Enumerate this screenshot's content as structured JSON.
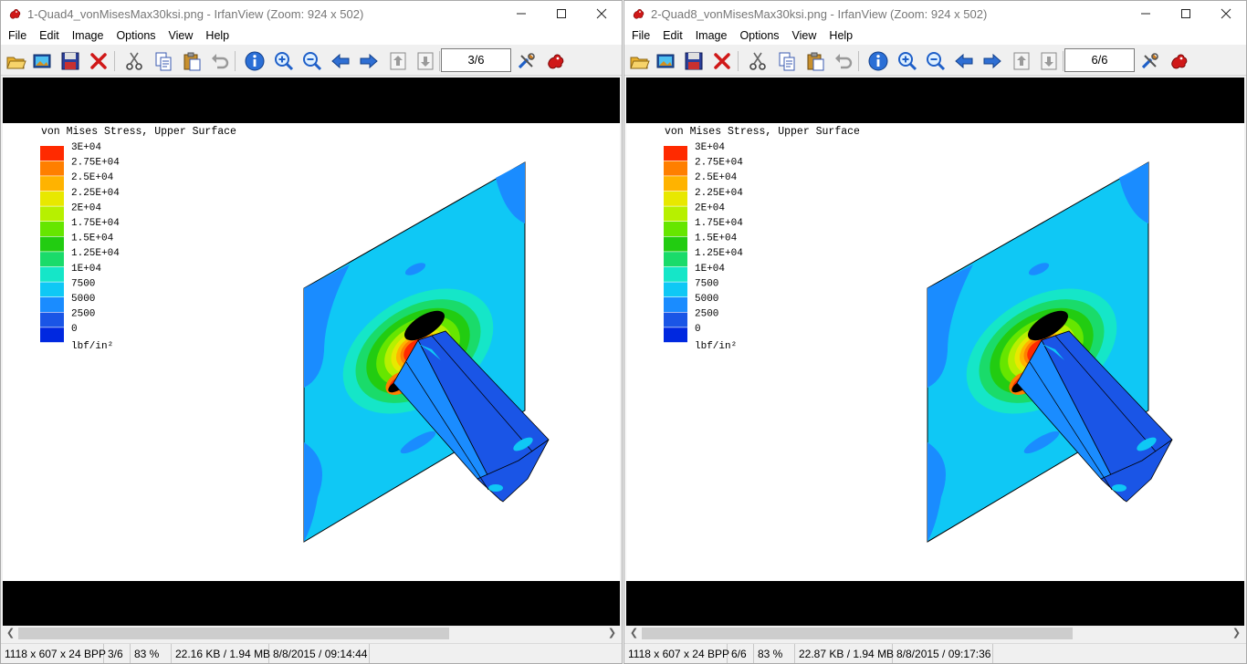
{
  "colors": {
    "accent_red": "#c81e1e",
    "plot_background": "#ffffff",
    "frame_black": "#000000"
  },
  "menu": [
    "File",
    "Edit",
    "Image",
    "Options",
    "View",
    "Help"
  ],
  "toolbar_icons": [
    "open-folder-icon",
    "slideshow-icon",
    "save-icon",
    "delete-icon",
    "cut-icon",
    "copy-icon",
    "paste-icon",
    "undo-icon",
    "info-icon",
    "zoom-in-icon",
    "zoom-out-icon",
    "previous-icon",
    "next-icon",
    "first-page-icon",
    "next-page-icon",
    "properties-icon",
    "irfanview-icon"
  ],
  "legend": {
    "title": "von Mises Stress, Upper Surface",
    "unit": "lbf/in²",
    "labels": [
      "3E+04",
      "2.75E+04",
      "2.5E+04",
      "2.25E+04",
      "2E+04",
      "1.75E+04",
      "1.5E+04",
      "1.25E+04",
      "1E+04",
      "7500",
      "5000",
      "2500",
      "0"
    ],
    "colors": [
      "#ff2a00",
      "#ff7f00",
      "#ffb300",
      "#e8e800",
      "#b7f000",
      "#66e600",
      "#22cc11",
      "#1adb6a",
      "#15e6c8",
      "#0fc8f5",
      "#1a8cff",
      "#1a55e6",
      "#0028e0"
    ]
  },
  "windows": [
    {
      "title": "1-Quad4_vonMisesMax30ksi.png - IrfanView (Zoom: 924 x 502)",
      "page_field": "3/6",
      "status": {
        "dims": "1118 x 607 x 24 BPP",
        "page": "3/6",
        "zoom": "83 %",
        "size": "22.16 KB / 1.94 MB",
        "datetime": "8/8/2015 / 09:14:44"
      }
    },
    {
      "title": "2-Quad8_vonMisesMax30ksi.png - IrfanView (Zoom: 924 x 502)",
      "page_field": "6/6",
      "status": {
        "dims": "1118 x 607 x 24 BPP",
        "page": "6/6",
        "zoom": "83 %",
        "size": "22.87 KB / 1.94 MB",
        "datetime": "8/8/2015 / 09:17:36"
      }
    }
  ]
}
